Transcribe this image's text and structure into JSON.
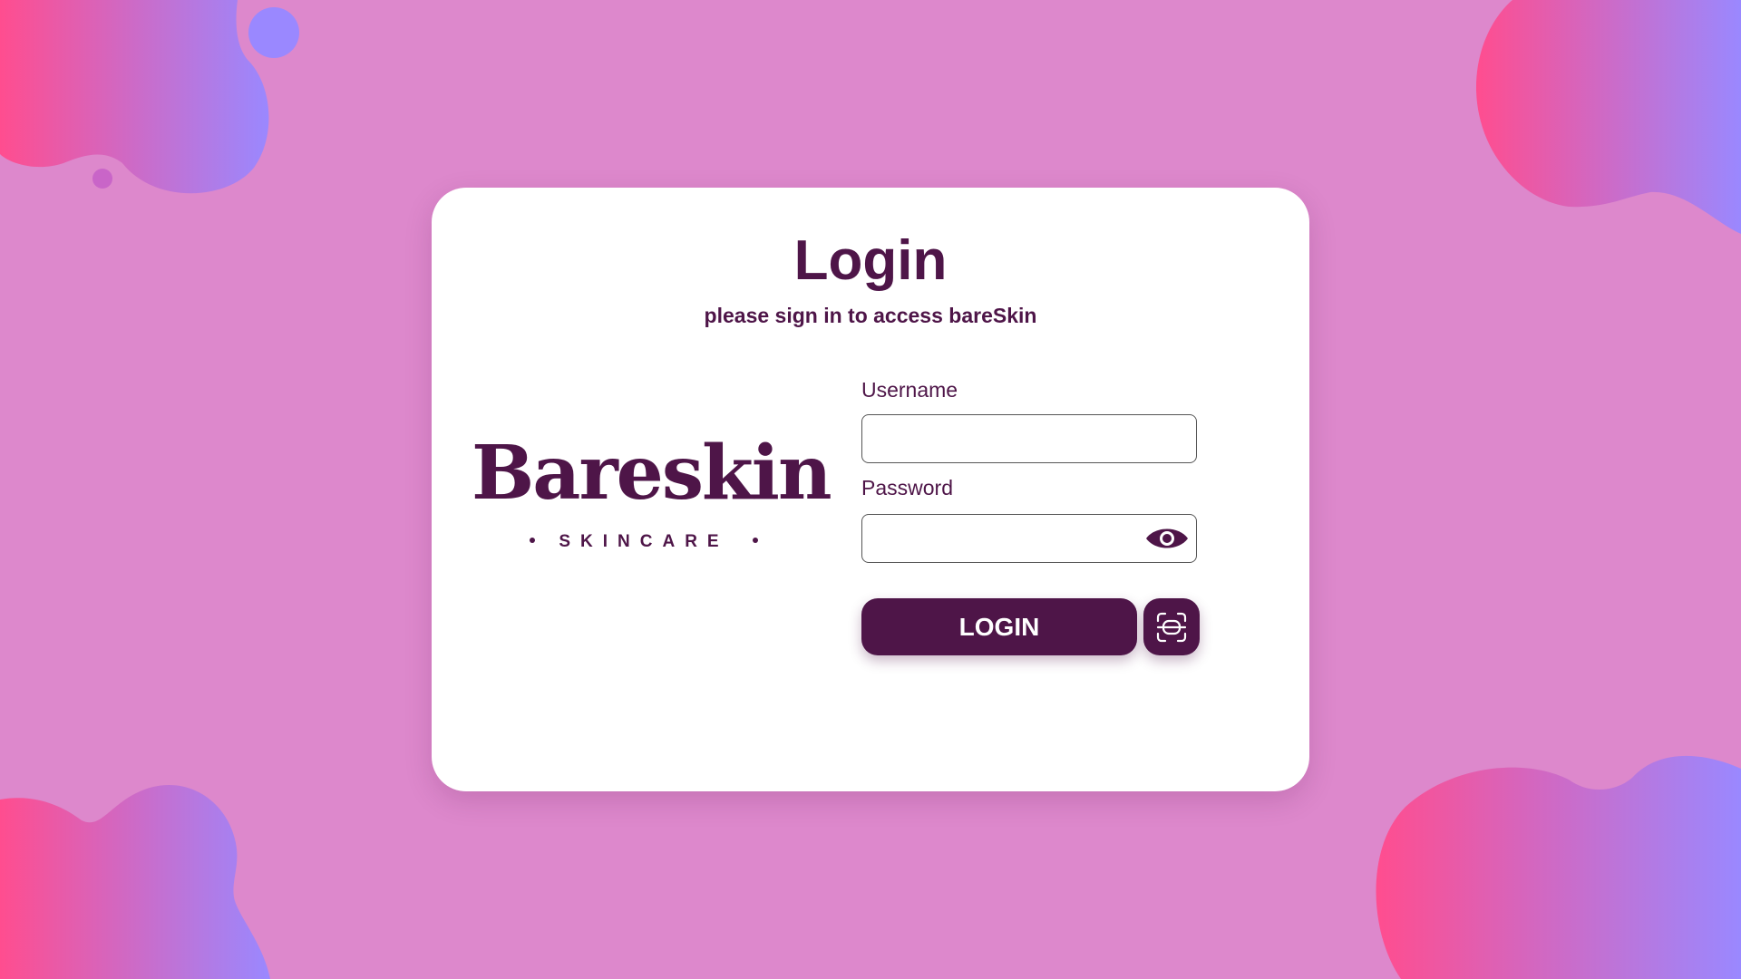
{
  "login": {
    "title": "Login",
    "subtitle": "please sign in to access bareSkin",
    "logo": {
      "wordmark": "Bareskin",
      "tagline": "SKINCARE"
    },
    "username": {
      "label": "Username",
      "value": "",
      "placeholder": ""
    },
    "password": {
      "label": "Password",
      "value": "",
      "placeholder": ""
    },
    "login_button": "LOGIN",
    "icons": {
      "password_toggle": "eye-icon",
      "alt_login": "face-scan-icon"
    }
  },
  "colors": {
    "background": "#dd88cc",
    "brand": "#4e1548",
    "card": "#ffffff",
    "blob_pink": "#ff4d8f",
    "blob_violet": "#9a88ff"
  }
}
